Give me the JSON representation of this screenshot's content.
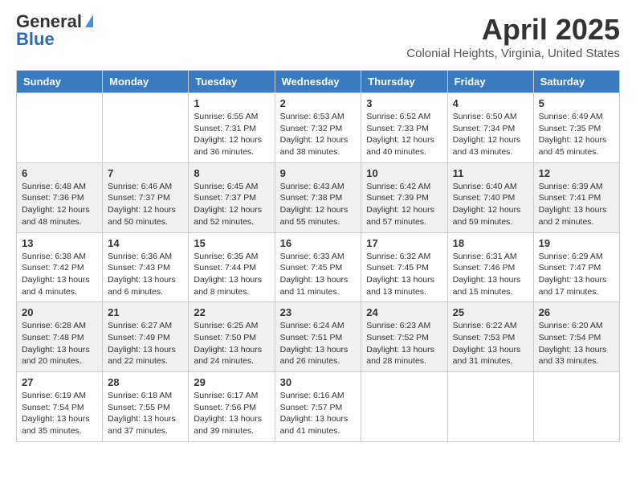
{
  "header": {
    "logo_general": "General",
    "logo_blue": "Blue",
    "month": "April 2025",
    "location": "Colonial Heights, Virginia, United States"
  },
  "days_of_week": [
    "Sunday",
    "Monday",
    "Tuesday",
    "Wednesday",
    "Thursday",
    "Friday",
    "Saturday"
  ],
  "weeks": [
    [
      {
        "day": "",
        "info": ""
      },
      {
        "day": "",
        "info": ""
      },
      {
        "day": "1",
        "info": "Sunrise: 6:55 AM\nSunset: 7:31 PM\nDaylight: 12 hours\nand 36 minutes."
      },
      {
        "day": "2",
        "info": "Sunrise: 6:53 AM\nSunset: 7:32 PM\nDaylight: 12 hours\nand 38 minutes."
      },
      {
        "day": "3",
        "info": "Sunrise: 6:52 AM\nSunset: 7:33 PM\nDaylight: 12 hours\nand 40 minutes."
      },
      {
        "day": "4",
        "info": "Sunrise: 6:50 AM\nSunset: 7:34 PM\nDaylight: 12 hours\nand 43 minutes."
      },
      {
        "day": "5",
        "info": "Sunrise: 6:49 AM\nSunset: 7:35 PM\nDaylight: 12 hours\nand 45 minutes."
      }
    ],
    [
      {
        "day": "6",
        "info": "Sunrise: 6:48 AM\nSunset: 7:36 PM\nDaylight: 12 hours\nand 48 minutes."
      },
      {
        "day": "7",
        "info": "Sunrise: 6:46 AM\nSunset: 7:37 PM\nDaylight: 12 hours\nand 50 minutes."
      },
      {
        "day": "8",
        "info": "Sunrise: 6:45 AM\nSunset: 7:37 PM\nDaylight: 12 hours\nand 52 minutes."
      },
      {
        "day": "9",
        "info": "Sunrise: 6:43 AM\nSunset: 7:38 PM\nDaylight: 12 hours\nand 55 minutes."
      },
      {
        "day": "10",
        "info": "Sunrise: 6:42 AM\nSunset: 7:39 PM\nDaylight: 12 hours\nand 57 minutes."
      },
      {
        "day": "11",
        "info": "Sunrise: 6:40 AM\nSunset: 7:40 PM\nDaylight: 12 hours\nand 59 minutes."
      },
      {
        "day": "12",
        "info": "Sunrise: 6:39 AM\nSunset: 7:41 PM\nDaylight: 13 hours\nand 2 minutes."
      }
    ],
    [
      {
        "day": "13",
        "info": "Sunrise: 6:38 AM\nSunset: 7:42 PM\nDaylight: 13 hours\nand 4 minutes."
      },
      {
        "day": "14",
        "info": "Sunrise: 6:36 AM\nSunset: 7:43 PM\nDaylight: 13 hours\nand 6 minutes."
      },
      {
        "day": "15",
        "info": "Sunrise: 6:35 AM\nSunset: 7:44 PM\nDaylight: 13 hours\nand 8 minutes."
      },
      {
        "day": "16",
        "info": "Sunrise: 6:33 AM\nSunset: 7:45 PM\nDaylight: 13 hours\nand 11 minutes."
      },
      {
        "day": "17",
        "info": "Sunrise: 6:32 AM\nSunset: 7:45 PM\nDaylight: 13 hours\nand 13 minutes."
      },
      {
        "day": "18",
        "info": "Sunrise: 6:31 AM\nSunset: 7:46 PM\nDaylight: 13 hours\nand 15 minutes."
      },
      {
        "day": "19",
        "info": "Sunrise: 6:29 AM\nSunset: 7:47 PM\nDaylight: 13 hours\nand 17 minutes."
      }
    ],
    [
      {
        "day": "20",
        "info": "Sunrise: 6:28 AM\nSunset: 7:48 PM\nDaylight: 13 hours\nand 20 minutes."
      },
      {
        "day": "21",
        "info": "Sunrise: 6:27 AM\nSunset: 7:49 PM\nDaylight: 13 hours\nand 22 minutes."
      },
      {
        "day": "22",
        "info": "Sunrise: 6:25 AM\nSunset: 7:50 PM\nDaylight: 13 hours\nand 24 minutes."
      },
      {
        "day": "23",
        "info": "Sunrise: 6:24 AM\nSunset: 7:51 PM\nDaylight: 13 hours\nand 26 minutes."
      },
      {
        "day": "24",
        "info": "Sunrise: 6:23 AM\nSunset: 7:52 PM\nDaylight: 13 hours\nand 28 minutes."
      },
      {
        "day": "25",
        "info": "Sunrise: 6:22 AM\nSunset: 7:53 PM\nDaylight: 13 hours\nand 31 minutes."
      },
      {
        "day": "26",
        "info": "Sunrise: 6:20 AM\nSunset: 7:54 PM\nDaylight: 13 hours\nand 33 minutes."
      }
    ],
    [
      {
        "day": "27",
        "info": "Sunrise: 6:19 AM\nSunset: 7:54 PM\nDaylight: 13 hours\nand 35 minutes."
      },
      {
        "day": "28",
        "info": "Sunrise: 6:18 AM\nSunset: 7:55 PM\nDaylight: 13 hours\nand 37 minutes."
      },
      {
        "day": "29",
        "info": "Sunrise: 6:17 AM\nSunset: 7:56 PM\nDaylight: 13 hours\nand 39 minutes."
      },
      {
        "day": "30",
        "info": "Sunrise: 6:16 AM\nSunset: 7:57 PM\nDaylight: 13 hours\nand 41 minutes."
      },
      {
        "day": "",
        "info": ""
      },
      {
        "day": "",
        "info": ""
      },
      {
        "day": "",
        "info": ""
      }
    ]
  ]
}
